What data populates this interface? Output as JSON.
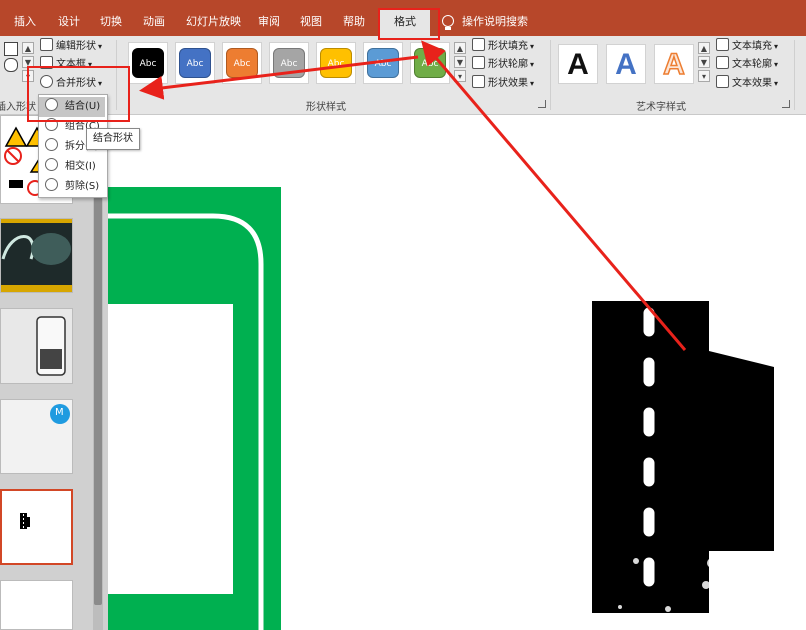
{
  "tabs": [
    {
      "label": "插入"
    },
    {
      "label": "设计"
    },
    {
      "label": "切换"
    },
    {
      "label": "动画"
    },
    {
      "label": "幻灯片放映"
    },
    {
      "label": "审阅"
    },
    {
      "label": "视图"
    },
    {
      "label": "帮助"
    },
    {
      "label": "格式"
    }
  ],
  "active_tab_index": 8,
  "tell_me": "操作说明搜索",
  "ribbon": {
    "insert_shapes": {
      "label": "插入形状",
      "edit_shape": "编辑形状",
      "text_box": "文本框",
      "merge_shapes": "合并形状"
    },
    "shape_styles": {
      "label": "形状样式",
      "swatches": [
        {
          "text": "Abc",
          "fill": "#000000",
          "border": "#000000"
        },
        {
          "text": "Abc",
          "fill": "#4472c4",
          "border": "#2f528f"
        },
        {
          "text": "Abc",
          "fill": "#ed7d31",
          "border": "#ae5a21"
        },
        {
          "text": "Abc",
          "fill": "#a5a5a5",
          "border": "#787878"
        },
        {
          "text": "Abc",
          "fill": "#ffc000",
          "border": "#bc8c00"
        },
        {
          "text": "Abc",
          "fill": "#5b9bd5",
          "border": "#41719c"
        },
        {
          "text": "Abc",
          "fill": "#70ad47",
          "border": "#507e32"
        }
      ],
      "shape_fill": "形状填充",
      "shape_outline": "形状轮廓",
      "shape_effects": "形状效果"
    },
    "wordart_styles": {
      "label": "艺术字样式",
      "samples": [
        {
          "text": "A",
          "color": "#111111"
        },
        {
          "text": "A",
          "color": "#4472c4"
        },
        {
          "text": "A",
          "color": "#fbe5d6",
          "stroke": "#ed7d31"
        }
      ],
      "text_fill": "文本填充",
      "text_outline": "文本轮廓",
      "text_effects": "文本效果"
    }
  },
  "merge_menu": {
    "items": [
      {
        "label": "结合(U)",
        "highlighted": true
      },
      {
        "label": "组合(C)",
        "highlighted": false
      },
      {
        "label": "拆分(F)",
        "highlighted": false
      },
      {
        "label": "相交(I)",
        "highlighted": false
      },
      {
        "label": "剪除(S)",
        "highlighted": false
      }
    ]
  },
  "tooltip": "结合形状",
  "thumbnails": [
    {
      "kind": "signs"
    },
    {
      "kind": "photo-dark"
    },
    {
      "kind": "phone"
    },
    {
      "kind": "badge",
      "badge_text": "M"
    },
    {
      "kind": "road-small",
      "selected": true
    },
    {
      "kind": "blank"
    }
  ],
  "colors": {
    "accent": "#b7472a",
    "highlight_red": "#e8221b",
    "sign_green": "#00b050",
    "selection_orange": "#d24726",
    "badge_blue": "#1f9be0"
  }
}
